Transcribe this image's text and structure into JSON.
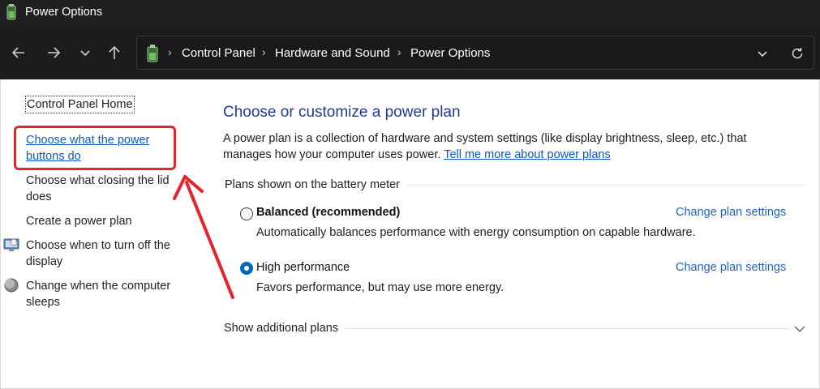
{
  "window": {
    "title": "Power Options"
  },
  "address_bar": {
    "breadcrumbs": [
      "Control Panel",
      "Hardware and Sound",
      "Power Options"
    ]
  },
  "sidebar": {
    "home": "Control Panel Home",
    "items": [
      {
        "lines": [
          "Choose what the power",
          "buttons do"
        ]
      },
      {
        "lines": [
          "Choose what closing the lid",
          "does"
        ]
      },
      {
        "lines": [
          "Create a power plan"
        ]
      },
      {
        "lines": [
          "Choose when to turn off the",
          "display"
        ]
      },
      {
        "lines": [
          "Change when the computer",
          "sleeps"
        ]
      }
    ]
  },
  "main": {
    "title": "Choose or customize a power plan",
    "description": "A power plan is a collection of hardware and system settings (like display brightness, sleep, etc.) that manages how your computer uses power.",
    "learn_more": "Tell me more about power plans",
    "group_label": "Plans shown on the battery meter",
    "plans": [
      {
        "name": "Balanced (recommended)",
        "description": "Automatically balances performance with energy consumption on capable hardware.",
        "link": "Change plan settings",
        "selected": false
      },
      {
        "name": "High performance",
        "description": "Favors performance, but may use more energy.",
        "link": "Change plan settings",
        "selected": true
      }
    ],
    "show_more": "Show additional plans"
  },
  "colors": {
    "title_bar": "#202020",
    "heading": "#1e3d8f",
    "link": "#0b57c5",
    "highlight": "#e8212a",
    "radio_selected": "#0067c0"
  }
}
